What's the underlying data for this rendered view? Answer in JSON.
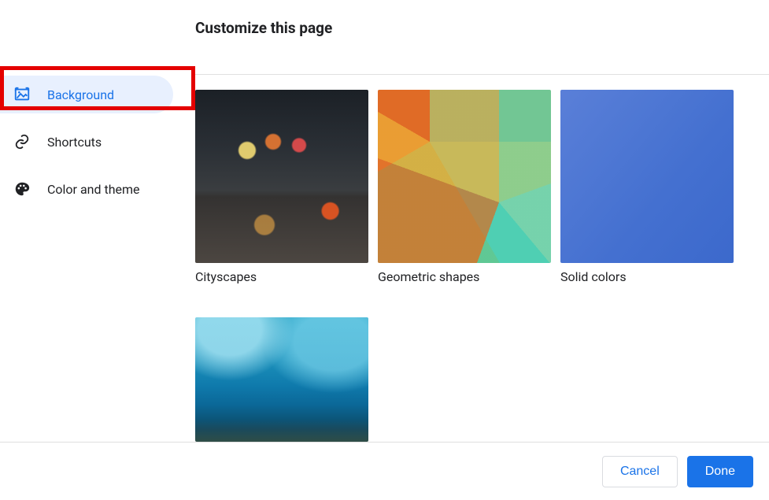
{
  "header": {
    "title": "Customize this page"
  },
  "sidebar": {
    "items": [
      {
        "id": "background",
        "label": "Background",
        "selected": true
      },
      {
        "id": "shortcuts",
        "label": "Shortcuts",
        "selected": false
      },
      {
        "id": "color",
        "label": "Color and theme",
        "selected": false
      }
    ]
  },
  "categories": [
    {
      "id": "cityscapes",
      "label": "Cityscapes"
    },
    {
      "id": "geometric",
      "label": "Geometric shapes"
    },
    {
      "id": "solid",
      "label": "Solid colors"
    },
    {
      "id": "underwater",
      "label": ""
    }
  ],
  "footer": {
    "cancel_label": "Cancel",
    "done_label": "Done"
  }
}
